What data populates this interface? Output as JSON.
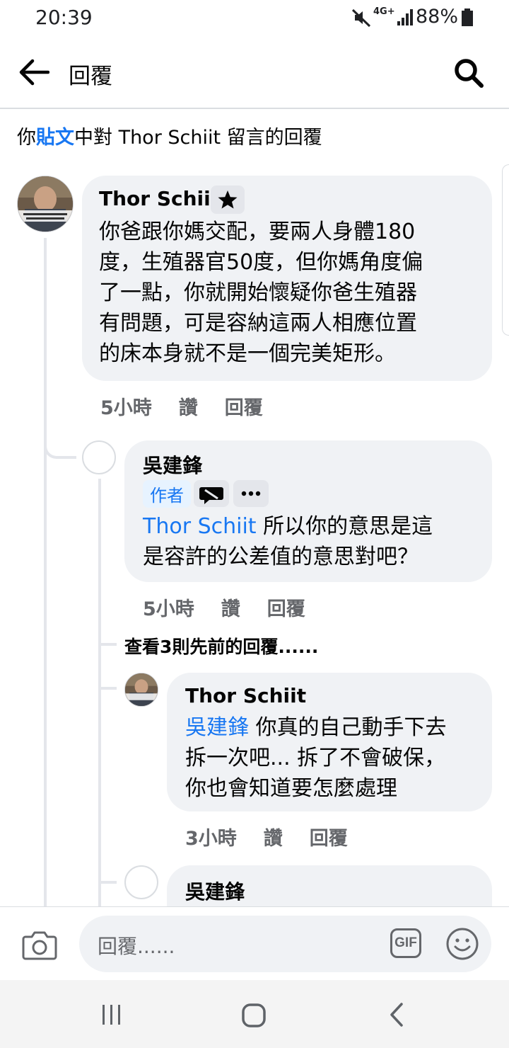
{
  "status_bar": {
    "time": "20:39",
    "network": "4G+",
    "battery": "88%"
  },
  "header": {
    "title": "回覆"
  },
  "context": {
    "prefix": "你",
    "link": "貼文",
    "suffix": "中對 Thor Schiit 留言的回覆"
  },
  "comments": [
    {
      "author": "Thor Schiit",
      "text_lines": [
        "你爸跟你媽交配，要兩人身體180",
        "度，生殖器官50度，但你媽角度偏",
        "了一點，你就開始懷疑你爸生殖器",
        "有問題，可是容納這兩人相應位置",
        "的床本身就不是一個完美矩形。"
      ],
      "time": "5小時",
      "like": "讚",
      "reply": "回覆"
    },
    {
      "author": "吳建鋒",
      "badge": "作者",
      "mention": "Thor Schiit",
      "text_line1_rest": " 所以你的意思是這",
      "text_line2": "是容許的公差值的意思對吧？",
      "time": "5小時",
      "like": "讚",
      "reply": "回覆"
    },
    {
      "view_previous": "查看3則先前的回覆......"
    },
    {
      "author": "Thor Schiit",
      "mention": "吳建鋒",
      "text_line1_rest": " 你真的自己動手下去",
      "text_line2": "拆一次吧... 拆了不會破保，",
      "text_line3": "你也會知道要怎麼處理",
      "time": "3小時",
      "like": "讚",
      "reply": "回覆"
    },
    {
      "author": "吳建鋒"
    }
  ],
  "composer": {
    "placeholder": "回覆......",
    "gif_label": "GIF"
  },
  "colors": {
    "accent": "#1877f2",
    "bubble": "#f0f2f5",
    "secondary_text": "#65676b"
  }
}
